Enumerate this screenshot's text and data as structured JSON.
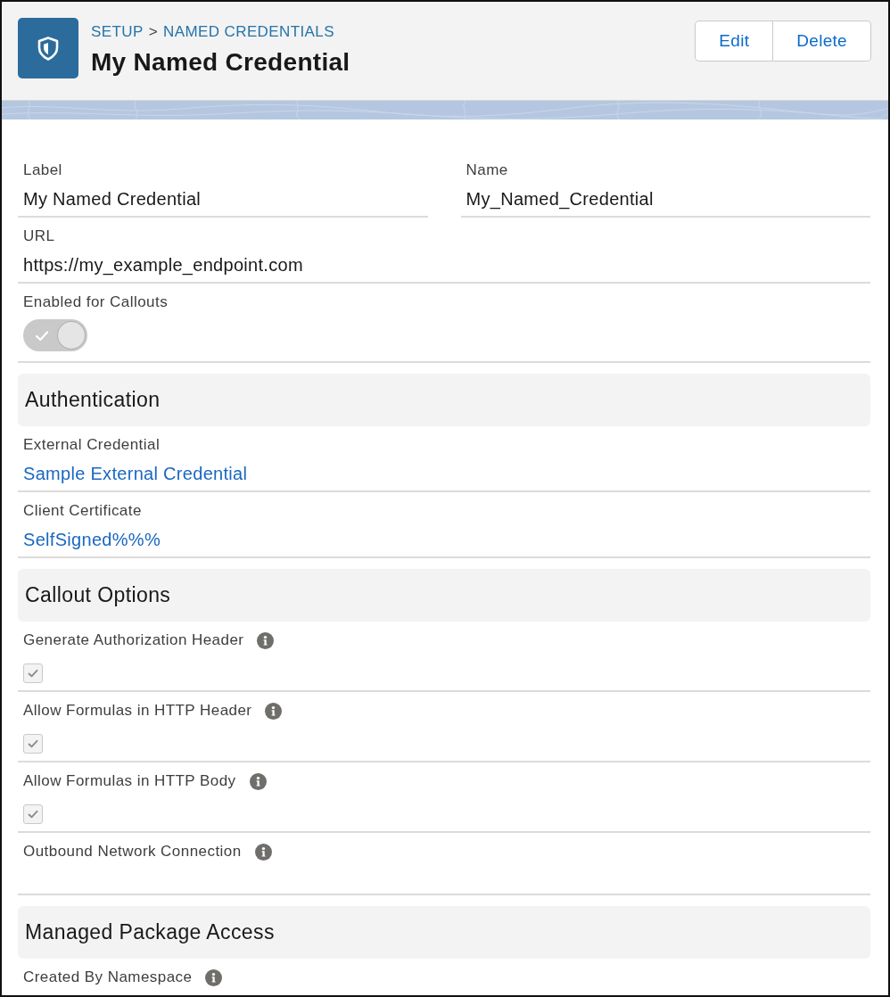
{
  "header": {
    "breadcrumb": {
      "items": [
        "SETUP",
        "NAMED CREDENTIALS"
      ],
      "separator": ">"
    },
    "title": "My Named Credential",
    "actions": [
      "Edit",
      "Delete"
    ]
  },
  "sections": [
    {
      "rows": [
        [
          {
            "label": "Label",
            "help": false,
            "kind": "text",
            "value": "My Named Credential"
          },
          {
            "label": "Name",
            "help": false,
            "kind": "text",
            "value": "My_Named_Credential"
          }
        ],
        [
          {
            "label": "URL",
            "help": false,
            "kind": "text",
            "value": "https://my_example_endpoint.com"
          }
        ],
        [
          {
            "label": "Enabled for Callouts",
            "help": false,
            "kind": "toggle",
            "on": true,
            "disabled": true
          }
        ]
      ]
    },
    {
      "title": "Authentication",
      "rows": [
        [
          {
            "label": "External Credential",
            "help": false,
            "kind": "link",
            "value": "Sample External Credential"
          }
        ],
        [
          {
            "label": "Client Certificate",
            "help": false,
            "kind": "link",
            "value": "SelfSigned%%%"
          }
        ]
      ]
    },
    {
      "title": "Callout Options",
      "rows": [
        [
          {
            "label": "Generate Authorization Header",
            "help": true,
            "kind": "checkbox",
            "checked": true,
            "disabled": true
          }
        ],
        [
          {
            "label": "Allow Formulas in HTTP Header",
            "help": true,
            "kind": "checkbox",
            "checked": true,
            "disabled": true
          }
        ],
        [
          {
            "label": "Allow Formulas in HTTP Body",
            "help": true,
            "kind": "checkbox",
            "checked": true,
            "disabled": true
          }
        ],
        [
          {
            "label": "Outbound Network Connection",
            "help": true,
            "kind": "text"
          }
        ]
      ]
    },
    {
      "title": "Managed Package Access",
      "rows": [
        [
          {
            "label": "Created By Namespace",
            "help": true,
            "kind": "text"
          }
        ]
      ]
    }
  ]
}
